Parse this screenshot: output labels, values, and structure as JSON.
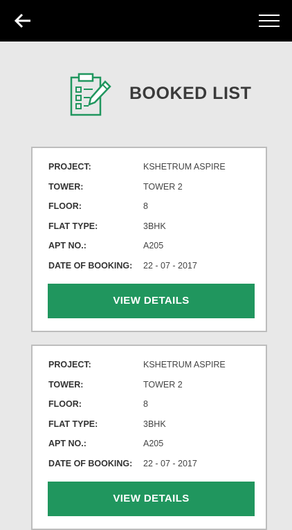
{
  "page": {
    "title": "BOOKED LIST"
  },
  "icons": {
    "back": "back-arrow-icon",
    "menu": "hamburger-menu-icon",
    "header": "clipboard-edit-icon"
  },
  "colors": {
    "topbar": "#000000",
    "accent": "#20965e",
    "background": "#e8e8e8"
  },
  "bookings": [
    {
      "fields": [
        {
          "label": "PROJECT:",
          "value": "KSHETRUM ASPIRE"
        },
        {
          "label": "TOWER:",
          "value": "TOWER 2"
        },
        {
          "label": "FLOOR:",
          "value": "8"
        },
        {
          "label": "FLAT TYPE:",
          "value": "3BHK"
        },
        {
          "label": "APT NO.:",
          "value": "A205"
        },
        {
          "label": "DATE OF BOOKING:",
          "value": "22 - 07 - 2017"
        }
      ],
      "button_label": "VIEW DETAILS"
    },
    {
      "fields": [
        {
          "label": "PROJECT:",
          "value": "KSHETRUM ASPIRE"
        },
        {
          "label": "TOWER:",
          "value": "TOWER 2"
        },
        {
          "label": "FLOOR:",
          "value": "8"
        },
        {
          "label": "FLAT TYPE:",
          "value": "3BHK"
        },
        {
          "label": "APT NO.:",
          "value": "A205"
        },
        {
          "label": "DATE OF BOOKING:",
          "value": "22 - 07 - 2017"
        }
      ],
      "button_label": "VIEW DETAILS"
    }
  ]
}
